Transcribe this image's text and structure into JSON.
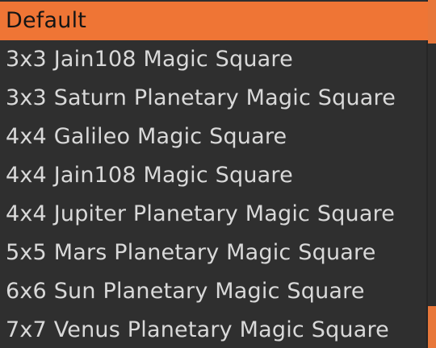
{
  "dropdown": {
    "selected_index": 0,
    "items": [
      {
        "label": "Default"
      },
      {
        "label": "3x3 Jain108 Magic Square"
      },
      {
        "label": "3x3 Saturn Planetary Magic Square"
      },
      {
        "label": "4x4 Galileo Magic Square"
      },
      {
        "label": "4x4 Jain108 Magic Square"
      },
      {
        "label": "4x4 Jupiter Planetary Magic Square"
      },
      {
        "label": "5x5 Mars Planetary Magic Square"
      },
      {
        "label": "6x6 Sun Planetary Magic Square"
      },
      {
        "label": "7x7 Venus Planetary Magic Square"
      }
    ]
  },
  "colors": {
    "accent": "#ef7535",
    "menu_background": "#2f2f2f",
    "item_text": "#d9d9d9",
    "selected_text": "#151515"
  }
}
